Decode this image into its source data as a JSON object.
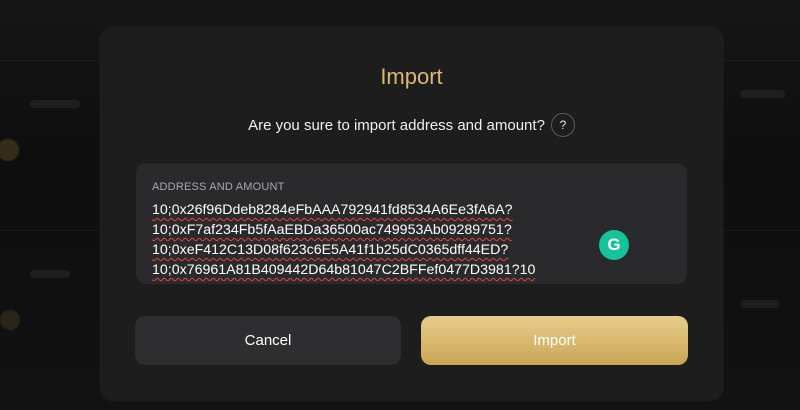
{
  "dialog": {
    "title": "Import",
    "question": "Are you sure to import address and amount?",
    "help_glyph": "?",
    "field": {
      "label": "ADDRESS AND AMOUNT",
      "value": "10;0x26f96Ddeb8284eFbAAA792941fd8534A6Ee3fA6A?\n10;0xF7af234Fb5fAaEBDa36500ac749953Ab09289751?\n10;0xeF412C13D08f623c6E5A41f1b25dC0365dff44ED?\n10;0x76961A81B409442D64b81047C2BFFef0477D3981?10"
    },
    "grammarly_glyph": "G",
    "buttons": {
      "cancel": "Cancel",
      "confirm": "Import"
    }
  },
  "colors": {
    "accent_gold": "#dcb76c",
    "panel": "#1d1d1e",
    "input_bg": "#2a2a2c",
    "grammarly": "#15c39a"
  },
  "icons": {
    "help": "question-mark-icon",
    "grammarly": "grammarly-icon"
  }
}
